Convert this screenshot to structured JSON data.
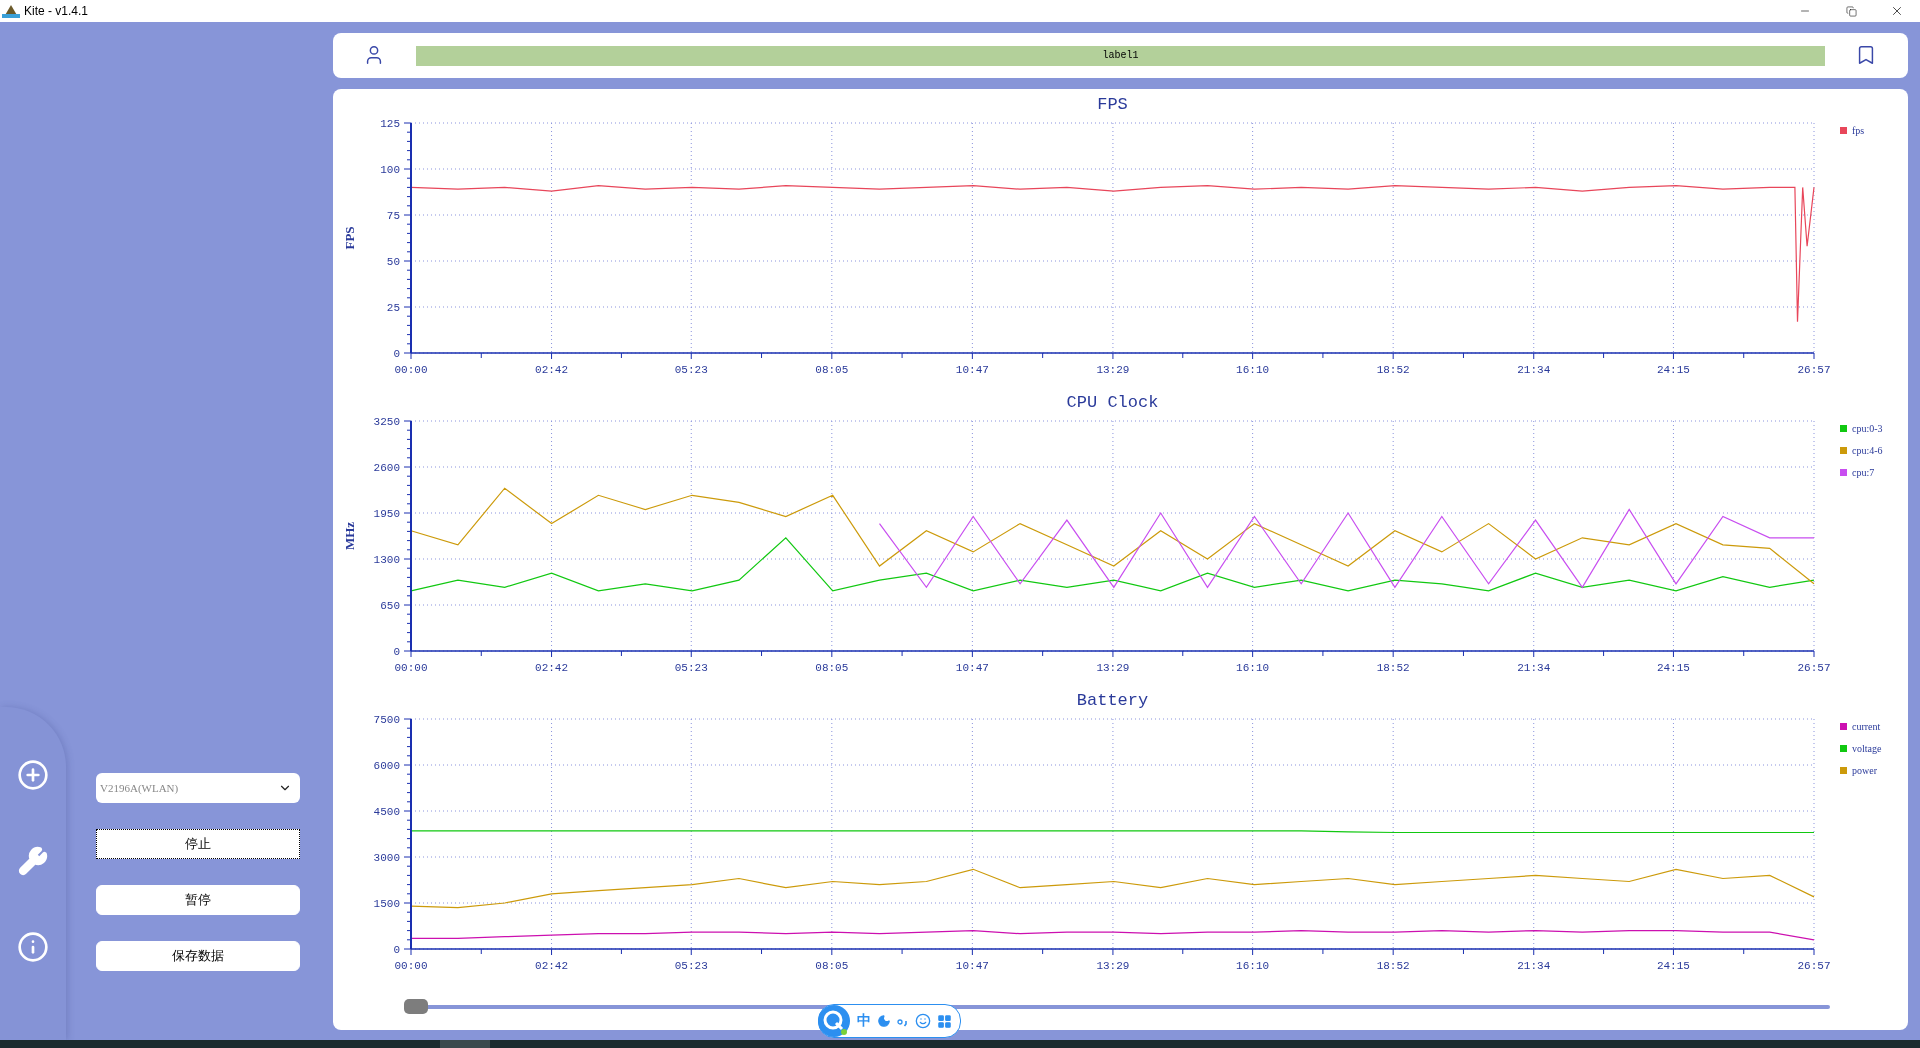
{
  "window": {
    "title": "Kite - v1.4.1"
  },
  "header": {
    "label": "label1"
  },
  "sidebar": {
    "device_select": {
      "value": "V2196A(WLAN)"
    },
    "buttons": [
      {
        "label": "停止",
        "focused": true
      },
      {
        "label": "暂停",
        "focused": false
      },
      {
        "label": "保存数据",
        "focused": false
      }
    ]
  },
  "charts": [
    {
      "chart_data": {
        "type": "line",
        "grid": true,
        "legend": true,
        "title": "FPS",
        "ylabel": "FPS",
        "xlim": [
          0,
          1617
        ],
        "ylim": [
          0,
          125
        ],
        "yticks": [
          0,
          25,
          50,
          75,
          100,
          125
        ],
        "xticks": [
          {
            "value": 0,
            "label": "00:00"
          },
          {
            "value": 162,
            "label": "02:42"
          },
          {
            "value": 323,
            "label": "05:23"
          },
          {
            "value": 485,
            "label": "08:05"
          },
          {
            "value": 647,
            "label": "10:47"
          },
          {
            "value": 809,
            "label": "13:29"
          },
          {
            "value": 970,
            "label": "16:10"
          },
          {
            "value": 1132,
            "label": "18:52"
          },
          {
            "value": 1294,
            "label": "21:34"
          },
          {
            "value": 1455,
            "label": "24:15"
          },
          {
            "value": 1617,
            "label": "26:57"
          }
        ],
        "x": [
          0,
          54,
          108,
          162,
          216,
          270,
          324,
          378,
          432,
          486,
          540,
          594,
          648,
          702,
          756,
          810,
          864,
          918,
          972,
          1026,
          1080,
          1134,
          1188,
          1242,
          1296,
          1350,
          1404,
          1458,
          1512,
          1566,
          1595,
          1598,
          1604,
          1609,
          1617
        ],
        "series": [
          {
            "name": "fps",
            "color": "#e8465a",
            "values": [
              90,
              89,
              90,
              88,
              91,
              89,
              90,
              89,
              91,
              90,
              89,
              90,
              91,
              89,
              90,
              88,
              90,
              91,
              89,
              90,
              89,
              91,
              90,
              89,
              90,
              88,
              90,
              91,
              89,
              90,
              90,
              17,
              90,
              58,
              90
            ]
          }
        ]
      }
    },
    {
      "chart_data": {
        "type": "line",
        "grid": true,
        "legend": true,
        "title": "CPU Clock",
        "ylabel": "MHz",
        "xlim": [
          0,
          1617
        ],
        "ylim": [
          0,
          3250
        ],
        "yticks": [
          0,
          650,
          1300,
          1950,
          2600,
          3250
        ],
        "xticks": [
          {
            "value": 0,
            "label": "00:00"
          },
          {
            "value": 162,
            "label": "02:42"
          },
          {
            "value": 323,
            "label": "05:23"
          },
          {
            "value": 485,
            "label": "08:05"
          },
          {
            "value": 647,
            "label": "10:47"
          },
          {
            "value": 809,
            "label": "13:29"
          },
          {
            "value": 970,
            "label": "16:10"
          },
          {
            "value": 1132,
            "label": "18:52"
          },
          {
            "value": 1294,
            "label": "21:34"
          },
          {
            "value": 1455,
            "label": "24:15"
          },
          {
            "value": 1617,
            "label": "26:57"
          }
        ],
        "x": [
          0,
          54,
          108,
          162,
          216,
          270,
          324,
          378,
          432,
          486,
          540,
          594,
          648,
          702,
          756,
          810,
          864,
          918,
          972,
          1026,
          1080,
          1134,
          1188,
          1242,
          1296,
          1350,
          1404,
          1458,
          1512,
          1566,
          1617
        ],
        "series": [
          {
            "name": "cpu:0-3",
            "color": "#11c811",
            "values": [
              850,
              1000,
              900,
              1100,
              850,
              950,
              850,
              1000,
              1600,
              850,
              1000,
              1100,
              850,
              1000,
              900,
              1000,
              850,
              1100,
              900,
              1000,
              850,
              1000,
              950,
              850,
              1100,
              900,
              1000,
              850,
              1050,
              900,
              1000
            ]
          },
          {
            "name": "cpu:4-6",
            "color": "#cc9a0a",
            "values": [
              1700,
              1500,
              2300,
              1800,
              2200,
              2000,
              2200,
              2100,
              1900,
              2200,
              1200,
              1700,
              1400,
              1800,
              1500,
              1200,
              1700,
              1300,
              1800,
              1500,
              1200,
              1700,
              1400,
              1800,
              1300,
              1600,
              1500,
              1800,
              1500,
              1450,
              950
            ]
          },
          {
            "name": "cpu:7",
            "color": "#c84ef0",
            "values": [
              null,
              null,
              null,
              null,
              null,
              null,
              null,
              null,
              null,
              null,
              1800,
              900,
              1900,
              950,
              1850,
              900,
              1950,
              900,
              1900,
              950,
              1950,
              900,
              1900,
              950,
              1850,
              900,
              2000,
              950,
              1900,
              1600,
              1600
            ]
          }
        ]
      }
    },
    {
      "chart_data": {
        "type": "line",
        "grid": true,
        "legend": true,
        "title": "Battery",
        "xlim": [
          0,
          1617
        ],
        "ylim": [
          0,
          7500
        ],
        "yticks": [
          0,
          1500,
          3000,
          4500,
          6000,
          7500
        ],
        "xticks": [
          {
            "value": 0,
            "label": "00:00"
          },
          {
            "value": 162,
            "label": "02:42"
          },
          {
            "value": 323,
            "label": "05:23"
          },
          {
            "value": 485,
            "label": "08:05"
          },
          {
            "value": 647,
            "label": "10:47"
          },
          {
            "value": 809,
            "label": "13:29"
          },
          {
            "value": 970,
            "label": "16:10"
          },
          {
            "value": 1132,
            "label": "18:52"
          },
          {
            "value": 1294,
            "label": "21:34"
          },
          {
            "value": 1455,
            "label": "24:15"
          },
          {
            "value": 1617,
            "label": "26:57"
          }
        ],
        "x": [
          0,
          54,
          108,
          162,
          216,
          270,
          324,
          378,
          432,
          486,
          540,
          594,
          648,
          702,
          756,
          810,
          864,
          918,
          972,
          1026,
          1080,
          1134,
          1188,
          1242,
          1296,
          1350,
          1404,
          1458,
          1512,
          1566,
          1617
        ],
        "series": [
          {
            "name": "current",
            "color": "#cc10b0",
            "values": [
              350,
              350,
              400,
              450,
              500,
              500,
              550,
              550,
              500,
              550,
              500,
              550,
              600,
              500,
              550,
              550,
              500,
              550,
              550,
              600,
              550,
              550,
              600,
              550,
              600,
              550,
              600,
              600,
              550,
              550,
              300
            ]
          },
          {
            "name": "voltage",
            "color": "#11c811",
            "values": [
              3850,
              3850,
              3850,
              3850,
              3850,
              3850,
              3850,
              3850,
              3850,
              3850,
              3850,
              3850,
              3850,
              3850,
              3850,
              3850,
              3850,
              3850,
              3850,
              3850,
              3820,
              3800,
              3800,
              3800,
              3800,
              3800,
              3800,
              3800,
              3800,
              3800,
              3800
            ]
          },
          {
            "name": "power",
            "color": "#cc9a0a",
            "values": [
              1400,
              1350,
              1500,
              1800,
              1900,
              2000,
              2100,
              2300,
              2000,
              2200,
              2100,
              2200,
              2600,
              2000,
              2100,
              2200,
              2000,
              2300,
              2100,
              2200,
              2300,
              2100,
              2200,
              2300,
              2400,
              2300,
              2200,
              2600,
              2300,
              2400,
              1700
            ]
          }
        ]
      }
    }
  ],
  "range_slider": {
    "level": 0
  },
  "ime_toolbar": {
    "mode": "中"
  }
}
